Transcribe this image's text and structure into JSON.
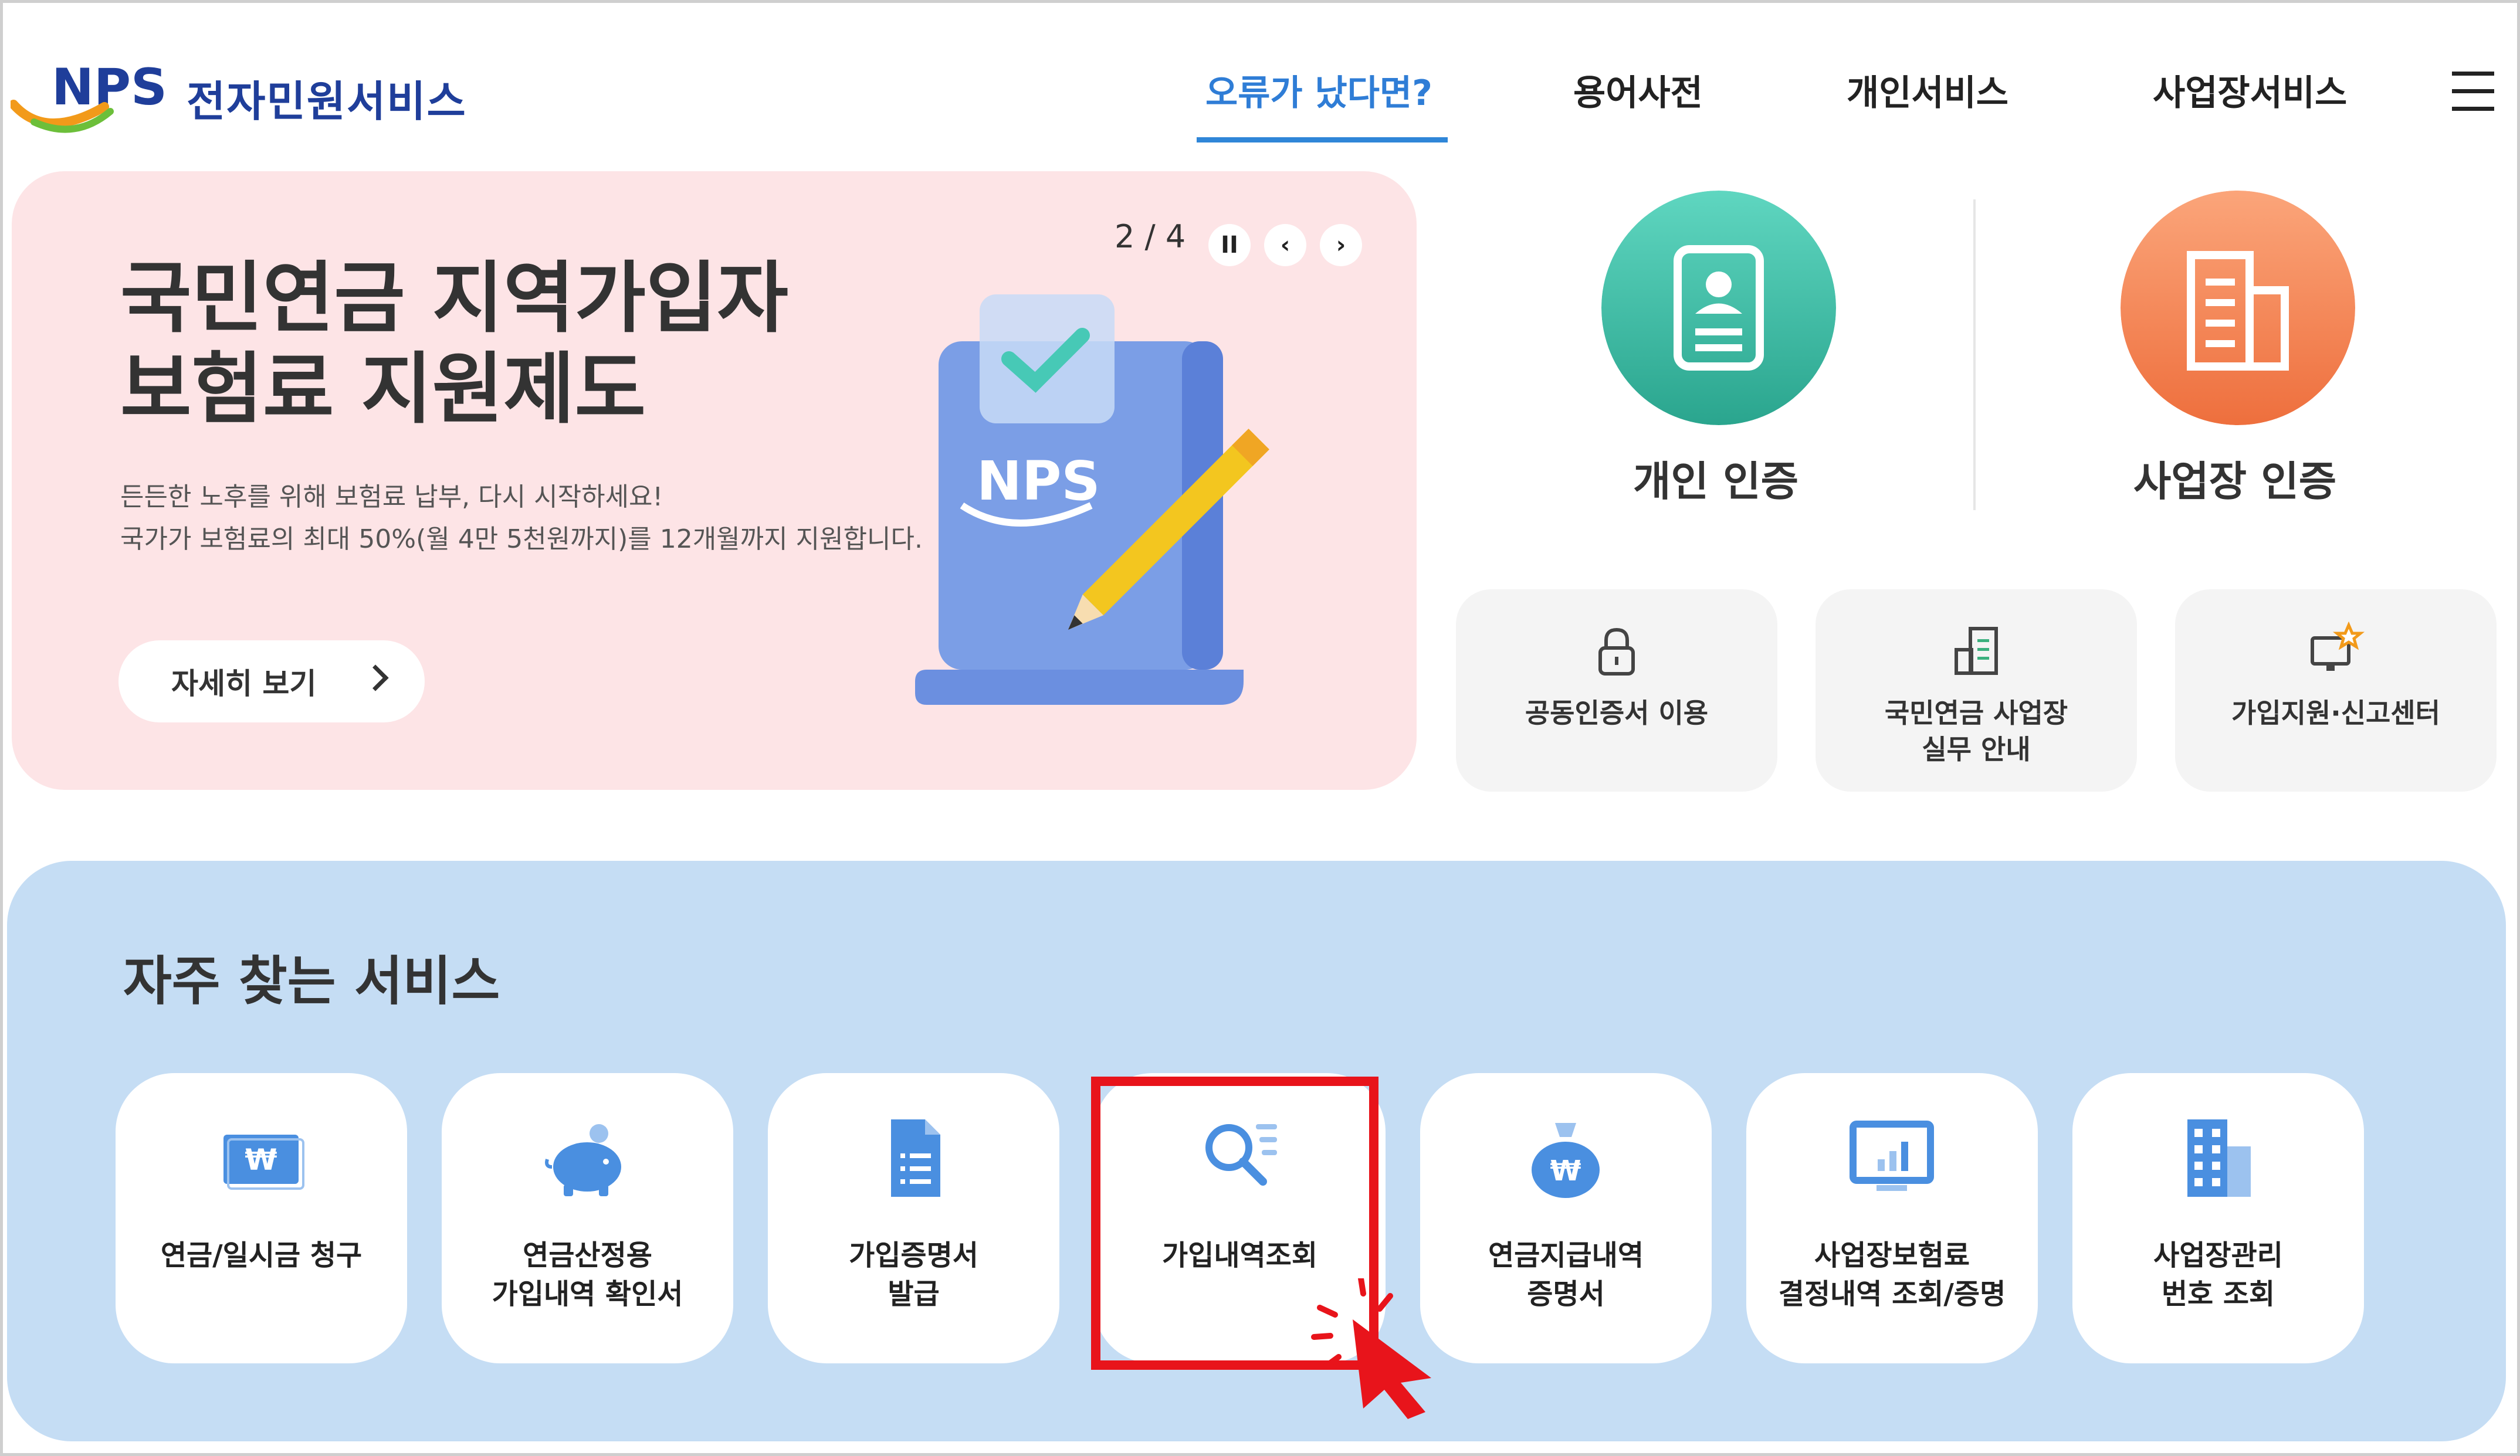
{
  "header": {
    "logo_text": "전자민원서비스",
    "nav": [
      {
        "label": "오류가 났다면?",
        "active": true
      },
      {
        "label": "용어사전",
        "active": false
      },
      {
        "label": "개인서비스",
        "active": false
      },
      {
        "label": "사업장서비스",
        "active": false
      }
    ],
    "menu_icon": "hamburger-icon"
  },
  "banner": {
    "title_line1": "국민연금 지역가입자",
    "title_line2": "보험료 지원제도",
    "desc_line1": "든든한 노후를 위해 보험료 납부, 다시 시작하세요!",
    "desc_line2": "국가가 보험료의 최대 50%(월 4만 5천원까지)를 12개월까지 지원합니다.",
    "more_label": "자세히 보기",
    "pager": "2 / 4",
    "pause_symbol": "II",
    "prev_symbol": "‹",
    "next_symbol": "›",
    "art_text": "NPS",
    "bg_color": "#fde4e6"
  },
  "certification": {
    "personal": {
      "label": "개인 인증",
      "icon": "id-card-icon",
      "color": "#3dbfa5"
    },
    "business": {
      "label": "사업장 인증",
      "icon": "building-icon",
      "color": "#f58a5c"
    }
  },
  "tiles": [
    {
      "line1": "공동인증서 이용",
      "line2": "",
      "icon": "lock-icon"
    },
    {
      "line1": "국민연금 사업장",
      "line2": "실무 안내",
      "icon": "document-building-icon"
    },
    {
      "line1": "가입지원·신고센터",
      "line2": "",
      "icon": "monitor-star-icon"
    }
  ],
  "services": {
    "title": "자주 찾는 서비스",
    "items": [
      {
        "line1": "연금/일시금 청구",
        "line2": "",
        "icon": "won-bill-icon"
      },
      {
        "line1": "연금산정용",
        "line2": "가입내역 확인서",
        "icon": "piggy-bank-icon"
      },
      {
        "line1": "가입증명서",
        "line2": "발급",
        "icon": "document-icon"
      },
      {
        "line1": "가입내역조회",
        "line2": "",
        "icon": "search-list-icon"
      },
      {
        "line1": "연금지급내역",
        "line2": "증명서",
        "icon": "money-bag-icon"
      },
      {
        "line1": "사업장보험료",
        "line2": "결정내역 조회/증명",
        "icon": "chart-monitor-icon"
      },
      {
        "line1": "사업장관리",
        "line2": "번호 조회",
        "icon": "office-building-icon"
      }
    ],
    "highlighted": "가입내역조회",
    "highlight_color": "#e8141b",
    "panel_color": "#c5ddf4"
  }
}
